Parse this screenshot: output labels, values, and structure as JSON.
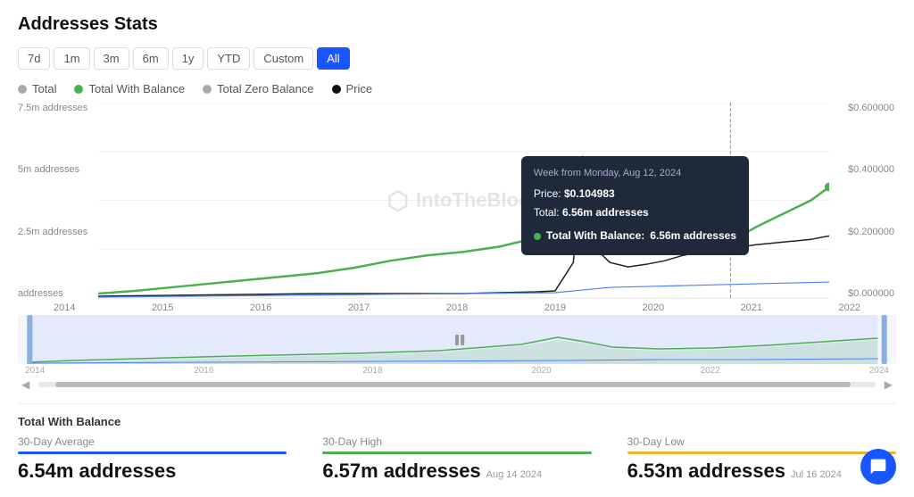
{
  "page": {
    "title": "Addresses Stats"
  },
  "filters": {
    "buttons": [
      "7d",
      "1m",
      "3m",
      "6m",
      "1y",
      "YTD",
      "Custom",
      "All"
    ],
    "active": "All"
  },
  "legend": {
    "items": [
      {
        "label": "Total",
        "color": "#aaa",
        "type": "dot"
      },
      {
        "label": "Total With Balance",
        "color": "#4caf50",
        "type": "dot"
      },
      {
        "label": "Total Zero Balance",
        "color": "#aaa",
        "type": "dot"
      },
      {
        "label": "Price",
        "color": "#111",
        "type": "dot"
      }
    ]
  },
  "chart": {
    "y_labels_left": [
      "7.5m addresses",
      "5m addresses",
      "2.5m addresses",
      "addresses"
    ],
    "y_labels_right": [
      "$0.600000",
      "$0.400000",
      "$0.200000",
      "$0.000000"
    ],
    "x_labels": [
      "2014",
      "2015",
      "2016",
      "2017",
      "2018",
      "2019",
      "2020",
      "2021",
      "2022"
    ],
    "watermark": "IntoTheBlock"
  },
  "tooltip": {
    "week": "Week from Monday, Aug 12, 2024",
    "price_label": "Price:",
    "price_value": "$0.104983",
    "total_label": "Total:",
    "total_value": "6.56m addresses",
    "balance_label": "Total With Balance:",
    "balance_value": "6.56m addresses"
  },
  "minimap": {
    "x_labels": [
      "2014",
      "2016",
      "2018",
      "2020",
      "2022",
      "2024"
    ]
  },
  "stats": {
    "section_label": "Total With Balance",
    "items": [
      {
        "type": "30-Day Average",
        "bar_color": "#1a56ff",
        "value": "6.54m addresses",
        "date": ""
      },
      {
        "type": "30-Day High",
        "bar_color": "#4caf50",
        "value": "6.57m addresses",
        "date": "Aug 14 2024"
      },
      {
        "type": "30-Day Low",
        "bar_color": "#f0b429",
        "value": "6.53m addresses",
        "date": "Jul 16 2024"
      }
    ]
  }
}
